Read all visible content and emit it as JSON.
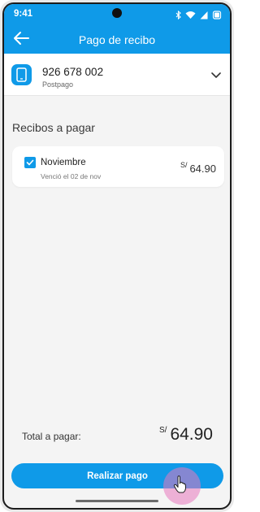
{
  "status_bar": {
    "time": "9:41"
  },
  "header": {
    "title": "Pago de recibo"
  },
  "line": {
    "number": "926 678 002",
    "plan": "Postpago"
  },
  "receipts": {
    "section_title": "Recibos a pagar",
    "items": [
      {
        "name": "Noviembre",
        "due": "Venció el 02 de nov",
        "currency": "S/",
        "amount": "64.90",
        "checked": true
      }
    ]
  },
  "total": {
    "label": "Total a pagar:",
    "currency": "S/",
    "amount": "64.90"
  },
  "actions": {
    "pay_label": "Realizar pago"
  },
  "colors": {
    "primary": "#0f9ae8",
    "background": "#f4f4f4",
    "tap_highlight": "#e778be"
  },
  "icons": [
    "back-arrow-icon",
    "phone-icon",
    "chevron-down-icon",
    "checkbox-checked-icon",
    "bluetooth-icon",
    "wifi-icon",
    "signal-icon",
    "battery-icon",
    "pointer-hand-icon"
  ]
}
